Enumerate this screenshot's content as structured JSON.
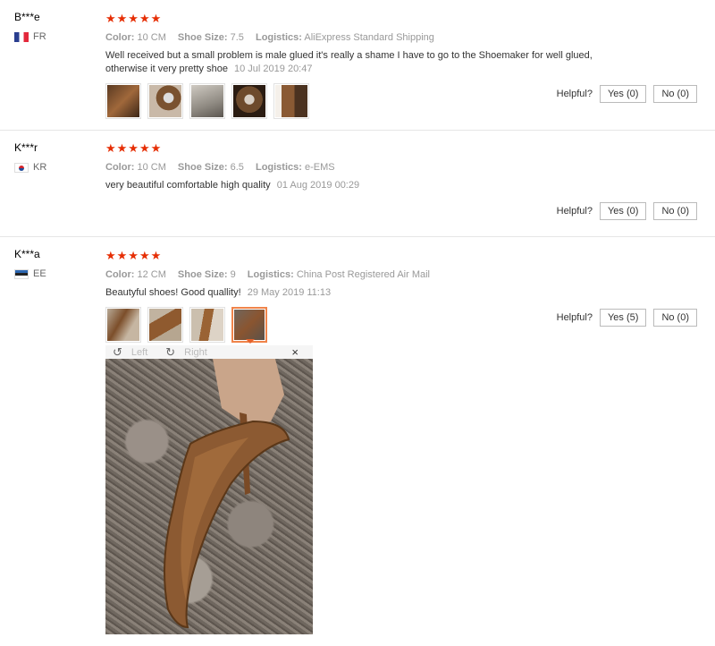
{
  "labels": {
    "color": "Color:",
    "shoe_size": "Shoe Size:",
    "logistics": "Logistics:",
    "helpful": "Helpful?"
  },
  "reviews": [
    {
      "user": "B***e",
      "country": "FR",
      "stars": "★★★★★",
      "color": "10 CM",
      "shoe_size": "7.5",
      "logistics": "AliExpress Standard Shipping",
      "text": "Well received but a small problem is male glued it's really a shame I have to go to the Shoemaker for well glued, otherwise it very pretty shoe",
      "date": "10 Jul 2019 20:47",
      "yes": "Yes (0)",
      "no": "No (0)"
    },
    {
      "user": "K***r",
      "country": "KR",
      "stars": "★★★★★",
      "color": "10 CM",
      "shoe_size": "6.5",
      "logistics": "e-EMS",
      "text": "very beautiful comfortable high quality",
      "date": "01 Aug 2019 00:29",
      "yes": "Yes (0)",
      "no": "No (0)"
    },
    {
      "user": "K***a",
      "country": "EE",
      "stars": "★★★★★",
      "color": "12 CM",
      "shoe_size": "9",
      "logistics": "China Post Registered Air Mail",
      "text": "Beautyful shoes! Good quallity!",
      "date": "29 May 2019 11:13",
      "yes": "Yes (5)",
      "no": "No (0)"
    }
  ],
  "viewer": {
    "left": "Left",
    "right": "Right",
    "close": "×"
  },
  "colors": {
    "star": "#e62e04",
    "accent": "#f0844a"
  }
}
